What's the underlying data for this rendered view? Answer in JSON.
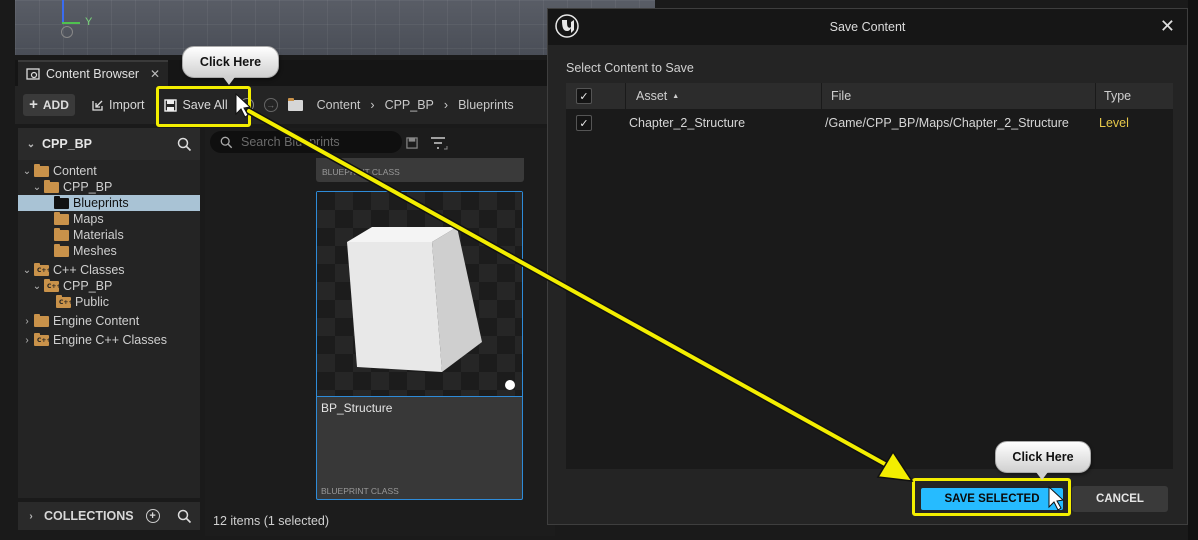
{
  "viewport": {
    "axis_label": "Y"
  },
  "content_browser": {
    "tab_label": "Content Browser",
    "add_label": "ADD",
    "import_label": "Import",
    "save_all_label": "Save All",
    "breadcrumb": [
      "Content",
      "CPP_BP",
      "Blueprints"
    ],
    "tree_root": "CPP_BP",
    "tree": [
      {
        "label": "Content",
        "depth": 0
      },
      {
        "label": "CPP_BP",
        "depth": 1
      },
      {
        "label": "Blueprints",
        "depth": 2,
        "selected": true
      },
      {
        "label": "Maps",
        "depth": 2
      },
      {
        "label": "Materials",
        "depth": 2
      },
      {
        "label": "Meshes",
        "depth": 2
      },
      {
        "label": "C++ Classes",
        "depth": 0
      },
      {
        "label": "CPP_BP",
        "depth": 1
      },
      {
        "label": "Public",
        "depth": 2
      },
      {
        "label": "Engine Content",
        "depth": 0
      },
      {
        "label": "Engine C++ Classes",
        "depth": 0
      }
    ],
    "collections_label": "COLLECTIONS",
    "search_placeholder": "Search Blueprints",
    "asset_top_class": "BLUEPRINT CLASS",
    "asset": {
      "name": "BP_Structure",
      "class": "BLUEPRINT CLASS"
    },
    "status": "12 items (1 selected)"
  },
  "dialog": {
    "title": "Save Content",
    "subtitle": "Select Content to Save",
    "columns": {
      "asset": "Asset",
      "file": "File",
      "type": "Type"
    },
    "rows": [
      {
        "asset": "Chapter_2_Structure",
        "file": "/Game/CPP_BP/Maps/Chapter_2_Structure",
        "type": "Level",
        "checked": true
      }
    ],
    "save_selected_label": "SAVE SELECTED",
    "cancel_label": "CANCEL"
  },
  "callouts": {
    "top": "Click Here",
    "bottom": "Click Here"
  },
  "colors": {
    "highlight": "#f3ee00",
    "accent": "#26bbff",
    "level_type": "#e6c84a",
    "folder": "#c9924a"
  }
}
